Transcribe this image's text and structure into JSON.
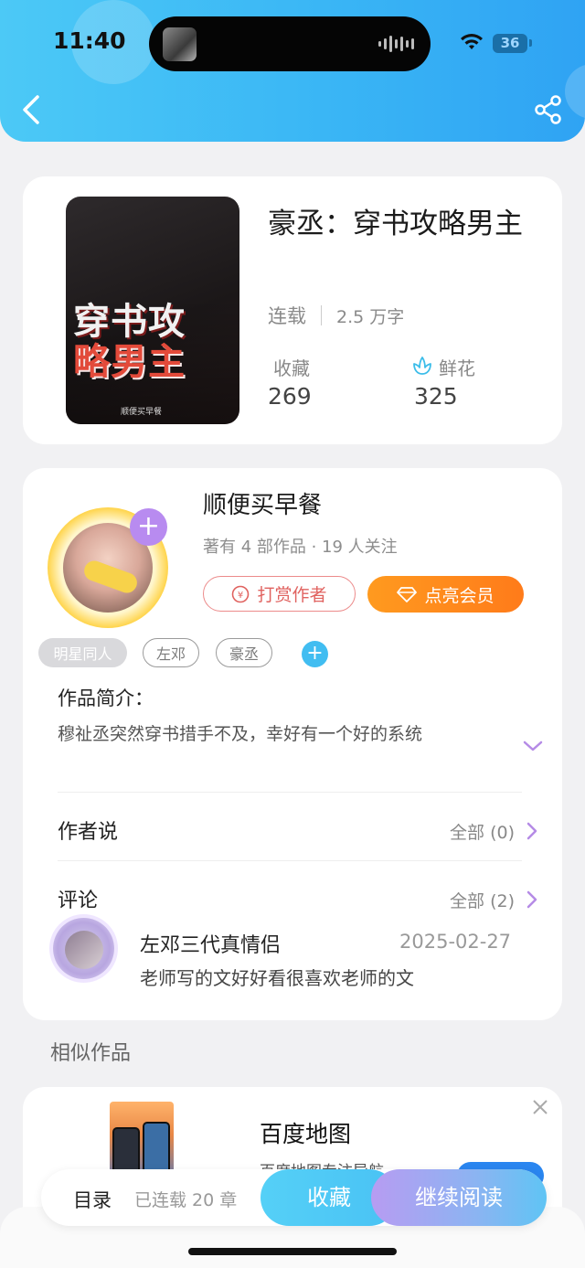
{
  "status_bar": {
    "time": "11:40",
    "battery": "36"
  },
  "book": {
    "title": "豪丞：穿书攻略男主",
    "cover_title_line1": "穿书攻",
    "cover_title_line2": "略男主",
    "cover_author": "顺便买早餐",
    "status": "连载",
    "word_count": "2.5 万字",
    "favorites_label": "收藏",
    "favorites_count": "269",
    "flowers_label": "鲜花",
    "flowers_count": "325"
  },
  "author": {
    "name": "顺便买早餐",
    "meta": "著有 4 部作品 · 19 人关注",
    "tip_label": "打赏作者",
    "vip_label": "点亮会员",
    "follow_label": "+"
  },
  "tags": [
    "明星同人",
    "左邓",
    "豪丞"
  ],
  "intro": {
    "title": "作品简介：",
    "text": "穆祉丞突然穿书措手不及，幸好有一个好的系统"
  },
  "author_says": {
    "title": "作者说",
    "link": "全部 (0)"
  },
  "comments": {
    "title": "评论",
    "link": "全部 (2)",
    "items": [
      {
        "user": "左邓三代真情侣",
        "date": "2025-02-27",
        "text": "老师写的文好好看很喜欢老师的文"
      }
    ]
  },
  "similar": {
    "title": "相似作品"
  },
  "ad": {
    "name": "百度地图",
    "desc": "百度地图专注导航"
  },
  "bottom_bar": {
    "toc": "目录",
    "serial": "已连载 20 章",
    "favorite": "收藏",
    "continue": "继续阅读"
  },
  "colors": {
    "header": "#3ab6f5",
    "accent_purple": "#b88bf0",
    "vip_orange": "#ff8a1c",
    "tip_red": "#e0625f"
  }
}
